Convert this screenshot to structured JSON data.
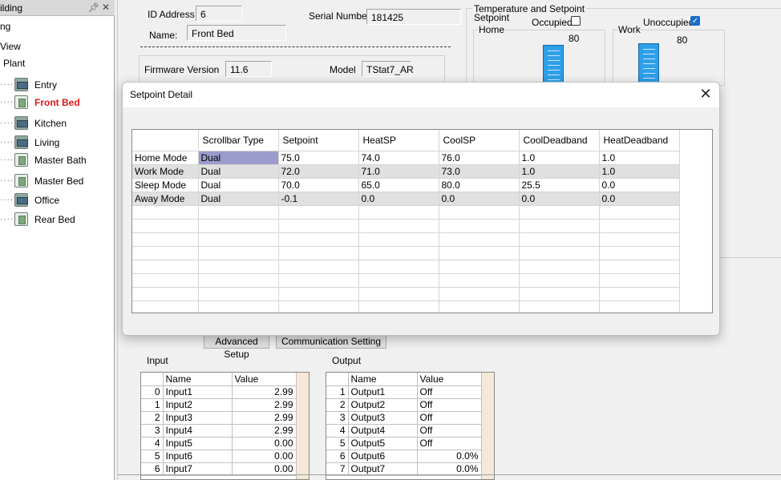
{
  "tree": {
    "header_title": "ilding",
    "items_top": [
      "ng",
      "View",
      "Plant"
    ],
    "devices": [
      {
        "label": "Entry",
        "active": false,
        "kind": "pc"
      },
      {
        "label": "Front Bed",
        "active": true,
        "kind": "tstat"
      },
      {
        "label": "Kitchen",
        "active": false,
        "kind": "pc"
      },
      {
        "label": "Living",
        "active": false,
        "kind": "pc"
      },
      {
        "label": "Master Bath",
        "active": false,
        "kind": "tstat"
      },
      {
        "label": "Master Bed",
        "active": false,
        "kind": "tstat"
      },
      {
        "label": "Office",
        "active": false,
        "kind": "pc"
      },
      {
        "label": "Rear Bed",
        "active": false,
        "kind": "tstat"
      }
    ]
  },
  "main": {
    "id_address_label": "ID Address",
    "id_address_value": "6",
    "serial_label": "Serial Number",
    "serial_value": "181425",
    "name_label": "Name:",
    "name_value": "Front Bed",
    "firmware_label": "Firmware Version",
    "firmware_value": "11.6",
    "model_label": "Model",
    "model_value": "TStat7_AR",
    "temp_group_title": "Temperature and Setpoint",
    "setpoint_label": "Setpoint",
    "occupied_label": "Occupied",
    "unoccupied_label": "Unoccupied",
    "home_label": "Home",
    "work_label": "Work",
    "home_value": "80",
    "work_value": "80",
    "advanced_setup": "Advanced Setup",
    "communication_setting": "Communication Setting",
    "input_title": "Input",
    "output_title": "Output",
    "input_headers": [
      "Name",
      "Value"
    ],
    "output_headers": [
      "Name",
      "Value"
    ],
    "inputs": [
      {
        "idx": "0",
        "name": "Input1",
        "value": "2.99"
      },
      {
        "idx": "1",
        "name": "Input2",
        "value": "2.99"
      },
      {
        "idx": "2",
        "name": "Input3",
        "value": "2.99"
      },
      {
        "idx": "3",
        "name": "Input4",
        "value": "2.99"
      },
      {
        "idx": "4",
        "name": "Input5",
        "value": "0.00"
      },
      {
        "idx": "5",
        "name": "Input6",
        "value": "0.00"
      },
      {
        "idx": "6",
        "name": "Input7",
        "value": "0.00"
      }
    ],
    "outputs": [
      {
        "idx": "1",
        "name": "Output1",
        "value": "Off"
      },
      {
        "idx": "2",
        "name": "Output2",
        "value": "Off"
      },
      {
        "idx": "3",
        "name": "Output3",
        "value": "Off"
      },
      {
        "idx": "4",
        "name": "Output4",
        "value": "Off"
      },
      {
        "idx": "5",
        "name": "Output5",
        "value": "Off"
      },
      {
        "idx": "6",
        "name": "Output6",
        "value": "0.0%"
      },
      {
        "idx": "7",
        "name": "Output7",
        "value": "0.0%"
      }
    ]
  },
  "dialog": {
    "title": "Setpoint Detail",
    "close_glyph": "✕",
    "headers": [
      "",
      "Scrollbar Type",
      "Setpoint",
      "HeatSP",
      "CoolSP",
      "CoolDeadband",
      "HeatDeadband"
    ],
    "rows": [
      [
        "Home Mode",
        "Dual",
        "75.0",
        "74.0",
        "76.0",
        "1.0",
        "1.0"
      ],
      [
        "Work Mode",
        "Dual",
        "72.0",
        "71.0",
        "73.0",
        "1.0",
        "1.0"
      ],
      [
        "Sleep Mode",
        "Dual",
        "70.0",
        "65.0",
        "80.0",
        "25.5",
        "0.0"
      ],
      [
        "Away Mode",
        "Dual",
        "-0.1",
        "0.0",
        "0.0",
        "0.0",
        "0.0"
      ]
    ],
    "empty_rows": 8
  }
}
